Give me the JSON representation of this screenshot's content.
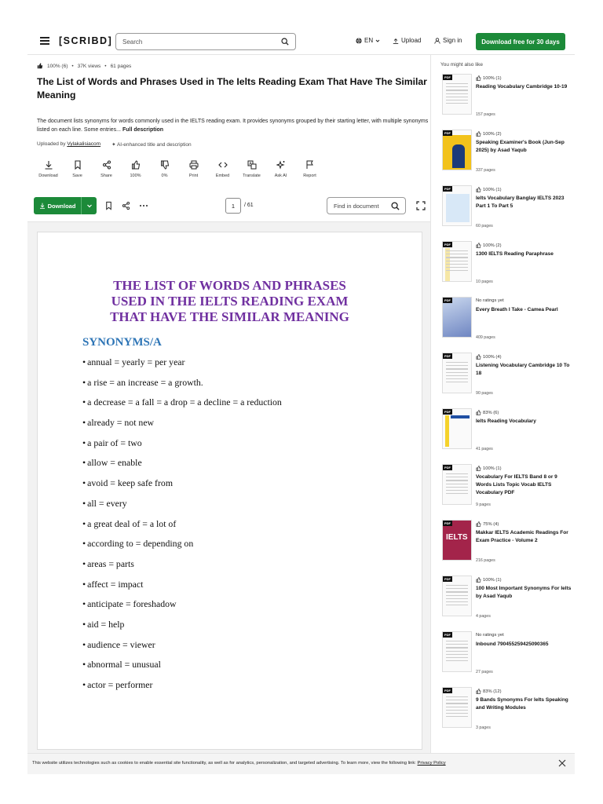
{
  "header": {
    "logo": "[SCRIBD]",
    "search_placeholder": "Search",
    "lang": "EN",
    "upload": "Upload",
    "signin": "Sign in",
    "cta": "Download free for 30 days",
    "brand_green": "#1c8a39"
  },
  "doc": {
    "rating": "100% (6)",
    "views": "37K views",
    "pages": "61 pages",
    "title": "The List of Words and Phrases Used in The Ielts Reading Exam That Have The Similar Meaning",
    "description": "The document lists synonyms for words commonly used in the IELTS reading exam. It provides synonyms grouped by their starting letter, with multiple synonyms listed on each line. Some entries...",
    "full_description": "Full description",
    "uploaded_by_label": "Uploaded by",
    "uploader": "Vylakalisiacom",
    "ai_note": "AI-enhanced title and description"
  },
  "actions": [
    {
      "label": "Download",
      "icon": "download-icon"
    },
    {
      "label": "Save",
      "icon": "bookmark-icon"
    },
    {
      "label": "Share",
      "icon": "share-icon"
    },
    {
      "label": "100%",
      "icon": "thumbs-up-icon"
    },
    {
      "label": "0%",
      "icon": "thumbs-down-icon"
    },
    {
      "label": "Print",
      "icon": "print-icon"
    },
    {
      "label": "Embed",
      "icon": "embed-icon"
    },
    {
      "label": "Translate",
      "icon": "translate-icon"
    },
    {
      "label": "Ask AI",
      "icon": "sparkle-icon"
    },
    {
      "label": "Report",
      "icon": "flag-icon"
    }
  ],
  "toolbar": {
    "download": "Download",
    "page_current": "1",
    "page_total": "/ 61",
    "find_placeholder": "Find in document"
  },
  "page": {
    "title_lines": [
      "THE LIST OF WORDS AND PHRASES",
      "USED IN THE IELTS READING EXAM",
      "THAT HAVE THE SIMILAR MEANING"
    ],
    "subtitle": "SYNONYMS/A",
    "items": [
      "annual = yearly = per year",
      "a rise = an increase = a growth.",
      "a decrease = a fall = a drop = a decline = a reduction",
      "already = not new",
      "a pair of = two",
      "allow = enable",
      "avoid = keep safe from",
      "all = every",
      "a great deal of = a lot of",
      "according to = depending on",
      "areas = parts",
      "affect = impact",
      "anticipate = foreshadow",
      "aid = help",
      "audience = viewer",
      "abnormal = unusual",
      "actor = performer"
    ]
  },
  "sidebar": {
    "heading": "You might also like",
    "items": [
      {
        "rating": "100% (1)",
        "title": "Reading Vocabulary Cambridge 10-19",
        "pages": "157 pages",
        "thumb": "plain"
      },
      {
        "rating": "100% (2)",
        "title": "Speaking Examiner's Book (Jun-Sep 2025) by Asad Yaqub",
        "pages": "337 pages",
        "thumb": "speaking"
      },
      {
        "rating": "100% (1)",
        "title": "Ielts Vocabulary Banglay IELTS 2023 Part 1 To Part 5",
        "pages": "60 pages",
        "thumb": "blue"
      },
      {
        "rating": "100% (2)",
        "title": "1300 IELTS Reading Paraphrase",
        "pages": "10 pages",
        "thumb": "table"
      },
      {
        "rating": "No ratings yet",
        "title": "Every Breath I Take - Camea Pearl",
        "pages": "409 pages",
        "thumb": "book"
      },
      {
        "rating": "100% (4)",
        "title": "Listening Vocabulary Cambridge 10 To 18",
        "pages": "90 pages",
        "thumb": "lines"
      },
      {
        "rating": "83% (6)",
        "title": "Ielts Reading Vocabulary",
        "pages": "41 pages",
        "thumb": "yellow"
      },
      {
        "rating": "100% (1)",
        "title": "Vocabulary For IELTS Band 8 or 9 Words Lists Topic Vocab IELTS Vocabulary PDF",
        "pages": "9 pages",
        "thumb": "lines"
      },
      {
        "rating": "75% (4)",
        "title": "Makkar IELTS Academic Readings For Exam Practice - Volume 2",
        "pages": "216 pages",
        "thumb": "ielts"
      },
      {
        "rating": "100% (1)",
        "title": "100 Most Important Synonyms For Ielts by Asad Yaqub",
        "pages": "4 pages",
        "thumb": "plain"
      },
      {
        "rating": "No ratings yet",
        "title": "Inbound 790455259425090365",
        "pages": "27 pages",
        "thumb": "lines"
      },
      {
        "rating": "83% (12)",
        "title": "9 Bands Synonyms For Ielts Speaking and Writing Modules",
        "pages": "3 pages",
        "thumb": "lines"
      }
    ]
  },
  "cookie": {
    "text": "This website utilizes technologies such as cookies to enable essential site functionality, as well as for analytics, personalization, and targeted advertising. To learn more, view the following link:",
    "link": "Privacy Policy"
  }
}
